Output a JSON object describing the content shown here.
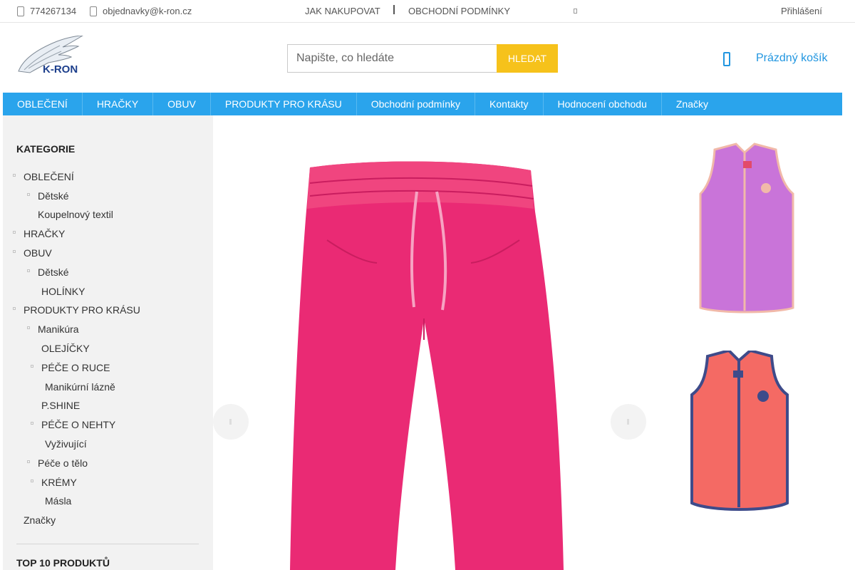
{
  "topbar": {
    "phone": "774267134",
    "email": "objednavky@k-ron.cz",
    "links": [
      "JAK NAKUPOVAT",
      "OBCHODNÍ PODMÍNKY"
    ],
    "login": "Přihlášení"
  },
  "header": {
    "logo_text": "K-RON",
    "search_placeholder": "Napište, co hledáte",
    "search_button": "HLEDAT",
    "cart_label": "Prázdný košík"
  },
  "nav": [
    "OBLEČENÍ",
    "HRAČKY",
    "OBUV",
    "PRODUKTY PRO KRÁSU",
    "Obchodní podmínky",
    "Kontakty",
    "Hodnocení obchodu",
    "Značky"
  ],
  "sidebar": {
    "title": "KATEGORIE",
    "categories": [
      {
        "label": "OBLEČENÍ",
        "bullet": true
      },
      {
        "label": "Dětské",
        "bullet": true
      },
      {
        "label": "Koupelnový textil",
        "bullet": false
      },
      {
        "label": "HRAČKY",
        "bullet": true
      },
      {
        "label": "OBUV",
        "bullet": true
      },
      {
        "label": "Dětské",
        "bullet": true
      },
      {
        "label": "HOLÍNKY",
        "bullet": false
      },
      {
        "label": "PRODUKTY PRO KRÁSU",
        "bullet": true
      },
      {
        "label": "Manikúra",
        "bullet": true
      },
      {
        "label": "OLEJÍČKY",
        "bullet": false
      },
      {
        "label": "PÉČE O RUCE",
        "bullet": true
      },
      {
        "label": "Manikúrní lázně",
        "bullet": false
      },
      {
        "label": "P.SHINE",
        "bullet": false
      },
      {
        "label": "PÉČE O NEHTY",
        "bullet": true
      },
      {
        "label": "Vyživující",
        "bullet": false
      },
      {
        "label": "Péče o tělo",
        "bullet": true
      },
      {
        "label": "KRÉMY",
        "bullet": true
      },
      {
        "label": "Másla",
        "bullet": false
      },
      {
        "label": "Značky",
        "bullet": false
      }
    ],
    "top10_title": "TOP 10 PRODUKTŮ"
  },
  "colors": {
    "accent": "#2aa4ec",
    "search_button": "#f6c21b",
    "cart_text": "#2196e0"
  },
  "icons": [
    "phone-icon",
    "mail-icon",
    "cart-icon",
    "arrow-left-icon",
    "arrow-right-icon"
  ]
}
